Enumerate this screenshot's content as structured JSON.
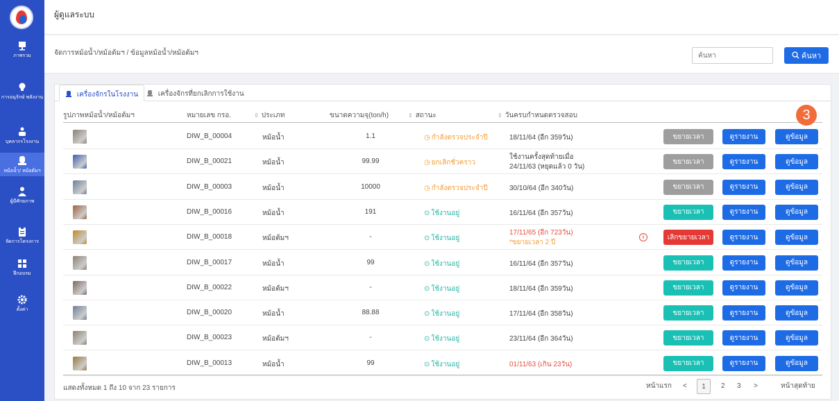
{
  "user_title": "ผู้ดูแลระบบ",
  "breadcrumb": "จัดการหม้อน้ำ/หม้อต้มฯ / ข้อมูลหม้อน้ำ/หม้อต้มฯ",
  "search": {
    "placeholder": "ค้นหา",
    "button_label": "ค้นหา"
  },
  "sidebar": [
    {
      "label": "ภาพรวม",
      "icon": "chart-icon"
    },
    {
      "label": "การอนุรักษ์ พลังงาน",
      "icon": "lightbulb-icon"
    },
    {
      "label": "บุคลากรโรงงาน",
      "icon": "people-icon"
    },
    {
      "label": "หม้อน้ำ/ หม้อต้มฯ",
      "icon": "boiler-icon",
      "active": true
    },
    {
      "label": "ผู้มีศักยภาพ",
      "icon": "person-icon"
    },
    {
      "label": "จัดการโครงการ",
      "icon": "clipboard-icon"
    },
    {
      "label": "ฝึกอบรม",
      "icon": "training-icon"
    },
    {
      "label": "ตั้งค่า",
      "icon": "gear-icon"
    }
  ],
  "tabs": [
    {
      "label": "เครื่องจักรในโรงงาน",
      "active": true
    },
    {
      "label": "เครื่องจักรที่ยกเลิกการใช้งาน",
      "active": false
    }
  ],
  "columns": {
    "image": "รูปภาพหม้อน้ำ/หม้อต้มฯ",
    "reg": "หมายเลข กรอ.",
    "type": "ประเภท",
    "capacity": "ขนาดความจุ(ton/h)",
    "status": "สถานะ",
    "due": "วันครบกำหนดตรวจสอบ"
  },
  "callout_number": "3",
  "rows": [
    {
      "reg": "DIW_B_00004",
      "type": "หม้อน้ำ",
      "capacity": "1.1",
      "status": "กำลังตรวจประจำปี",
      "status_kind": "orange",
      "due": "18/11/64 (อีก 359วัน)",
      "due2": "",
      "due_kind": "normal",
      "extend": "ขยายเวลา",
      "extend_kind": "gray",
      "report": "ดูรายงาน",
      "info": "ดูข้อมูล",
      "thumb": "#8a8270",
      "alert": false
    },
    {
      "reg": "DIW_B_00021",
      "type": "หม้อน้ำ",
      "capacity": "99.99",
      "status": "ยกเลิกชั่วคราว",
      "status_kind": "orange",
      "due": "ใช้งานครั้งสุดท้ายเมื่อ",
      "due2": "24/11/63 (หยุดแล้ว 0 วัน)",
      "due_kind": "normal",
      "extend": "ขยายเวลา",
      "extend_kind": "gray",
      "report": "ดูรายงาน",
      "info": "ดูข้อมูล",
      "thumb": "#3a5fb0",
      "alert": false
    },
    {
      "reg": "DIW_B_00003",
      "type": "หม้อน้ำ",
      "capacity": "10000",
      "status": "กำลังตรวจประจำปี",
      "status_kind": "orange",
      "due": "30/10/64 (อีก 340วัน)",
      "due2": "",
      "due_kind": "normal",
      "extend": "ขยายเวลา",
      "extend_kind": "gray",
      "report": "ดูรายงาน",
      "info": "ดูข้อมูล",
      "thumb": "#6b7f99",
      "alert": false
    },
    {
      "reg": "DIW_B_00016",
      "type": "หม้อน้ำ",
      "capacity": "191",
      "status": "ใช้งานอยู่",
      "status_kind": "green",
      "due": "16/11/64 (อีก 357วัน)",
      "due2": "",
      "due_kind": "normal",
      "extend": "ขยายเวลา",
      "extend_kind": "teal",
      "report": "ดูรายงาน",
      "info": "ดูข้อมูล",
      "thumb": "#a0623f",
      "alert": false
    },
    {
      "reg": "DIW_B_00018",
      "type": "หม้อต้มฯ",
      "capacity": "-",
      "status": "ใช้งานอยู่",
      "status_kind": "green",
      "due": "17/11/65 (อีก 723วัน)",
      "due2": "*ขยายเวลา 2 ปี",
      "due_kind": "orange",
      "extend": "เลิกขยายเวลา",
      "extend_kind": "red",
      "report": "ดูรายงาน",
      "info": "ดูข้อมูล",
      "thumb": "#c08a2a",
      "alert": true
    },
    {
      "reg": "DIW_B_00017",
      "type": "หม้อน้ำ",
      "capacity": "99",
      "status": "ใช้งานอยู่",
      "status_kind": "green",
      "due": "16/11/64 (อีก 357วัน)",
      "due2": "",
      "due_kind": "normal",
      "extend": "ขยายเวลา",
      "extend_kind": "teal",
      "report": "ดูรายงาน",
      "info": "ดูข้อมูล",
      "thumb": "#8a8270",
      "alert": false
    },
    {
      "reg": "DIW_B_00022",
      "type": "หม้อต้มฯ",
      "capacity": "-",
      "status": "ใช้งานอยู่",
      "status_kind": "green",
      "due": "18/11/64 (อีก 359วัน)",
      "due2": "",
      "due_kind": "normal",
      "extend": "ขยายเวลา",
      "extend_kind": "teal",
      "report": "ดูรายงาน",
      "info": "ดูข้อมูล",
      "thumb": "#7a6a60",
      "alert": false
    },
    {
      "reg": "DIW_B_00020",
      "type": "หม้อน้ำ",
      "capacity": "88.88",
      "status": "ใช้งานอยู่",
      "status_kind": "green",
      "due": "17/11/64 (อีก 358วัน)",
      "due2": "",
      "due_kind": "normal",
      "extend": "ขยายเวลา",
      "extend_kind": "teal",
      "report": "ดูรายงาน",
      "info": "ดูข้อมูล",
      "thumb": "#6b7f99",
      "alert": false
    },
    {
      "reg": "DIW_B_00023",
      "type": "หม้อต้มฯ",
      "capacity": "-",
      "status": "ใช้งานอยู่",
      "status_kind": "green",
      "due": "23/11/64 (อีก 364วัน)",
      "due2": "",
      "due_kind": "normal",
      "extend": "ขยายเวลา",
      "extend_kind": "teal",
      "report": "ดูรายงาน",
      "info": "ดูข้อมูล",
      "thumb": "#8a8270",
      "alert": false
    },
    {
      "reg": "DIW_B_00013",
      "type": "หม้อน้ำ",
      "capacity": "99",
      "status": "ใช้งานอยู่",
      "status_kind": "green",
      "due": "01/11/63 (เกิน 23วัน)",
      "due2": "",
      "due_kind": "red",
      "extend": "ขยายเวลา",
      "extend_kind": "teal",
      "report": "ดูรายงาน",
      "info": "ดูข้อมูล",
      "thumb": "#9a7a3a",
      "alert": false
    }
  ],
  "footer": {
    "summary": "แสดงทั้งหมด 1 ถึง 10 จาก 23 รายการ",
    "first": "หน้าแรก",
    "prev": "<",
    "pages": [
      "1",
      "2",
      "3"
    ],
    "next": ">",
    "last": "หน้าสุดท้าย"
  }
}
